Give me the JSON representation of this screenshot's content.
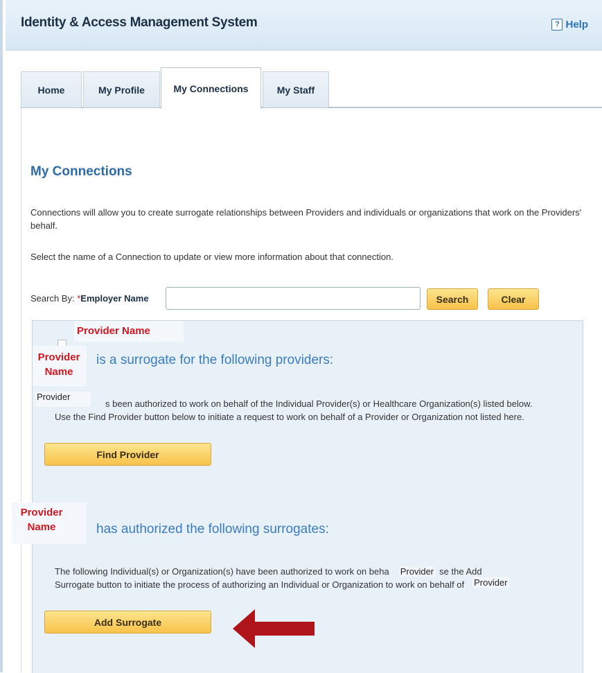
{
  "app": {
    "title": "Identity & Access Management System",
    "help_label": "Help",
    "help_glyph": "?"
  },
  "tabs": [
    {
      "label": "Home"
    },
    {
      "label": "My Profile"
    },
    {
      "label": "My Connections",
      "active": true
    },
    {
      "label": "My Staff"
    }
  ],
  "page": {
    "title": "My Connections",
    "intro": "Connections will allow you to create surrogate relationships between Providers and individuals or organizations that work on the Providers' behalf.",
    "instruction": "Select the name of a Connection to update or view more information about that connection."
  },
  "search": {
    "label": "Search By:",
    "required_marker": "*",
    "field_label": "Employer Name",
    "value": "",
    "search_button": "Search",
    "clear_button": "Clear"
  },
  "surrogate_for": {
    "top_label": "Provider Name",
    "name_label": "Provider Name",
    "heading": "is a surrogate for the following providers:",
    "overlay_word": "Provider",
    "line1": "s been authorized to work on behalf of the Individual Provider(s) or Healthcare Organization(s) listed below.",
    "line2": "Use the Find Provider button below to initiate a request to work on behalf of a Provider or Organization not listed here.",
    "button": "Find Provider"
  },
  "authorized_surrogates": {
    "name_label": "Provider Name",
    "heading": "has authorized the following surrogates:",
    "line1_part1": "The following Individual(s) or Organization(s) have been authorized to work on beha",
    "overlay_word_1": "Provider",
    "line1_part2": "se the Add",
    "line2": "Surrogate button to initiate the process of authorizing an Individual or Organization to work on behalf of",
    "overlay_word_2": "Provider",
    "button": "Add Surrogate"
  },
  "colors": {
    "accent_blue": "#2e6aa6",
    "annotation_red": "#d2171f",
    "arrow_red": "#b0141b",
    "button_gold": "#f8c24a"
  }
}
